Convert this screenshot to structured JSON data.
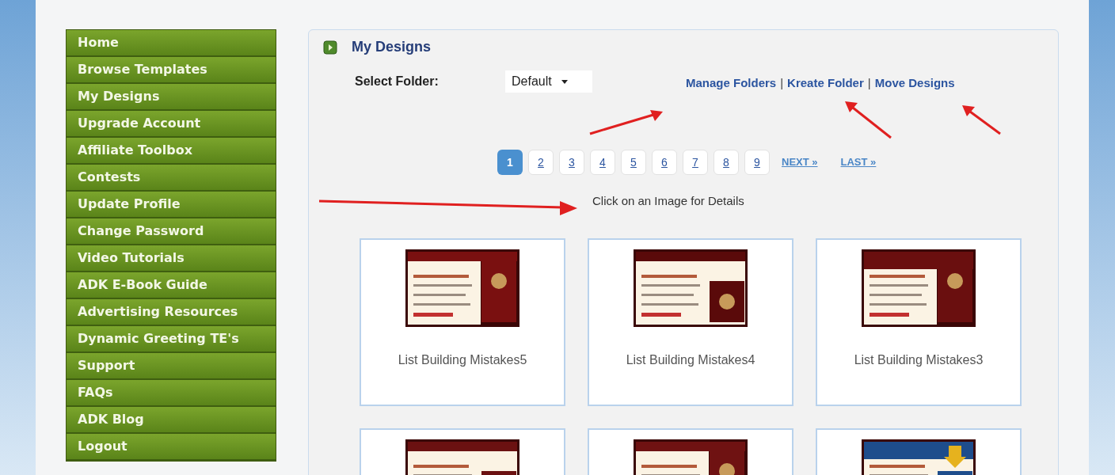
{
  "sidebar": {
    "items": [
      {
        "label": "Home"
      },
      {
        "label": "Browse Templates"
      },
      {
        "label": "My Designs"
      },
      {
        "label": "Upgrade Account"
      },
      {
        "label": "Affiliate Toolbox"
      },
      {
        "label": "Contests"
      },
      {
        "label": "Update Profile"
      },
      {
        "label": "Change Password"
      },
      {
        "label": "Video Tutorials"
      },
      {
        "label": "ADK E-Book Guide"
      },
      {
        "label": "Advertising Resources"
      },
      {
        "label": "Dynamic Greeting TE's"
      },
      {
        "label": "Support"
      },
      {
        "label": "FAQs"
      },
      {
        "label": "ADK Blog"
      },
      {
        "label": "Logout"
      }
    ]
  },
  "panel": {
    "title": "My Designs",
    "folder_label": "Select Folder:",
    "folder_value": "Default",
    "links": [
      "Manage Folders",
      "Kreate Folder",
      "Move Designs"
    ],
    "link_separator": "|",
    "pages": [
      {
        "label": "1",
        "selected": true
      },
      {
        "label": "2",
        "selected": false
      },
      {
        "label": "3",
        "selected": false
      },
      {
        "label": "4",
        "selected": false
      },
      {
        "label": "5",
        "selected": false
      },
      {
        "label": "6",
        "selected": false
      },
      {
        "label": "7",
        "selected": false
      },
      {
        "label": "8",
        "selected": false
      },
      {
        "label": "9",
        "selected": false
      }
    ],
    "next": "NEXT »",
    "last": "LAST »",
    "hint": "Click on an Image for Details",
    "cards": [
      {
        "kind": "titled",
        "title": "List Building Mistakes5"
      },
      {
        "kind": "titled",
        "title": "List Building Mistakes4"
      },
      {
        "kind": "titled",
        "title": "List Building Mistakes3"
      },
      {
        "kind": "cut"
      },
      {
        "kind": "cut"
      },
      {
        "kind": "cut"
      }
    ]
  }
}
